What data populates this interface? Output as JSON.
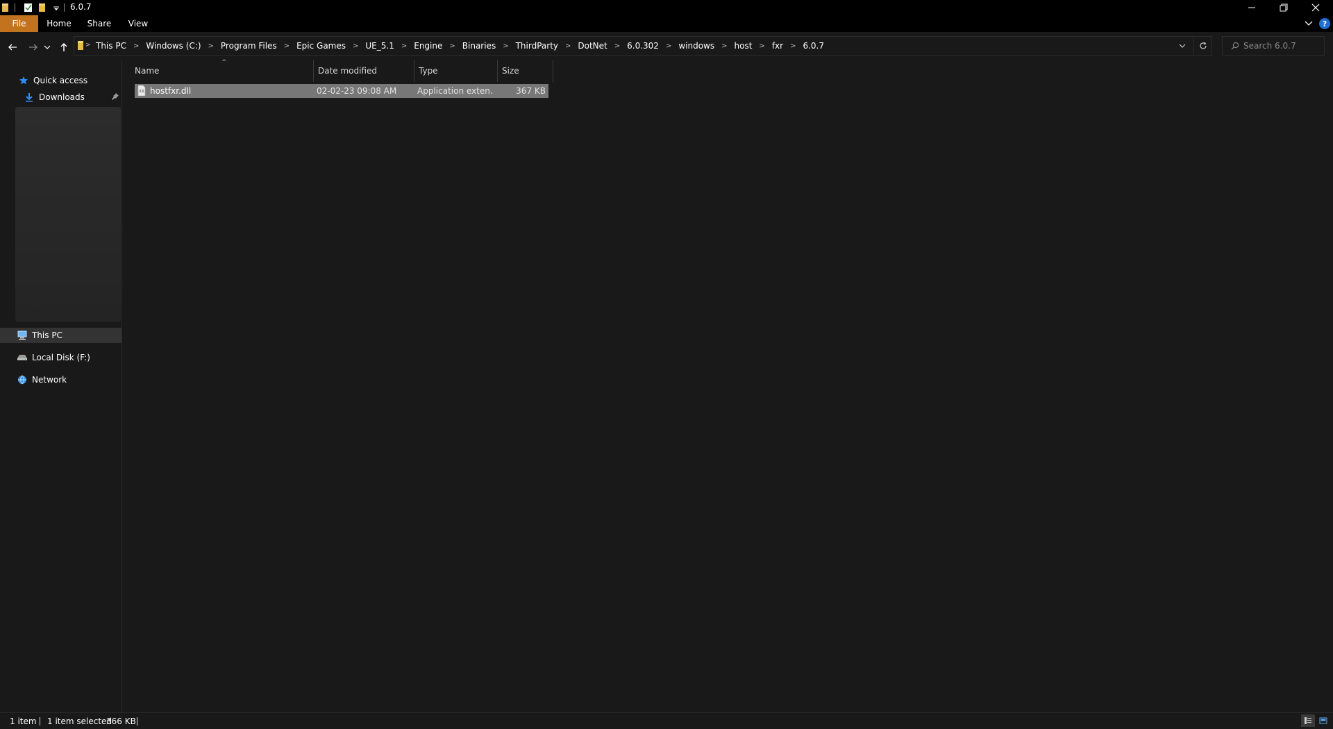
{
  "window": {
    "title": "6.0.7"
  },
  "ribbon": {
    "tabs": [
      "File",
      "Home",
      "Share",
      "View"
    ]
  },
  "address": {
    "crumbs": [
      "This PC",
      "Windows (C:)",
      "Program Files",
      "Epic Games",
      "UE_5.1",
      "Engine",
      "Binaries",
      "ThirdParty",
      "DotNet",
      "6.0.302",
      "windows",
      "host",
      "fxr",
      "6.0.7"
    ]
  },
  "search": {
    "placeholder": "Search 6.0.7"
  },
  "nav": {
    "quick_access": "Quick access",
    "downloads": "Downloads",
    "this_pc": "This PC",
    "local_disk": "Local Disk (F:)",
    "network": "Network"
  },
  "columns": {
    "name": "Name",
    "date": "Date modified",
    "type": "Type",
    "size": "Size"
  },
  "files": [
    {
      "name": "hostfxr.dll",
      "date": "02-02-23 09:08 AM",
      "type": "Application exten...",
      "size": "367 KB"
    }
  ],
  "status": {
    "count": "1 item",
    "selected": "1 item selected",
    "selected_size": "366 KB"
  },
  "colors": {
    "accent_file_tab": "#c3731e",
    "selection": "#777777",
    "background": "#191919"
  }
}
